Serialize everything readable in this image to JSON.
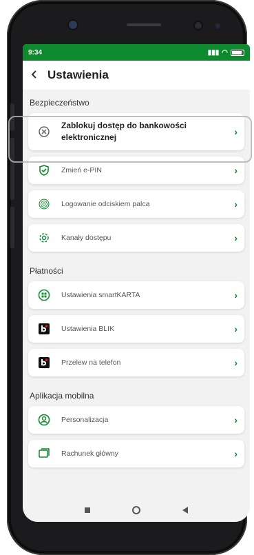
{
  "status": {
    "time": "9:34",
    "signal": "⁴⁶ıl",
    "battery": ""
  },
  "appbar": {
    "back_icon": "chevron-left-icon",
    "title": "Ustawienia"
  },
  "sections": {
    "security": {
      "title": "Bezpieczeństwo",
      "items": [
        {
          "label": "Zablokuj dostęp do bankowości elektronicznej",
          "icon": "block-icon"
        },
        {
          "label": "Zmień e-PIN",
          "icon": "shield-check-icon"
        },
        {
          "label": "Logowanie odciskiem palca",
          "icon": "fingerprint-icon"
        },
        {
          "label": "Kanały dostępu",
          "icon": "gear-icon"
        }
      ]
    },
    "payments": {
      "title": "Płatności",
      "items": [
        {
          "label": "Ustawienia smartKARTA",
          "icon": "smartkarta-icon"
        },
        {
          "label": "Ustawienia BLIK",
          "icon": "blik-icon"
        },
        {
          "label": "Przelew na telefon",
          "icon": "blik-icon"
        }
      ]
    },
    "mobile": {
      "title": "Aplikacja mobilna",
      "items": [
        {
          "label": "Personalizacja",
          "icon": "user-circle-icon"
        },
        {
          "label": "Rachunek główny",
          "icon": "account-icon"
        }
      ]
    }
  },
  "colors": {
    "brand": "#0e8a2e",
    "chevron": "#0c8a2b"
  }
}
